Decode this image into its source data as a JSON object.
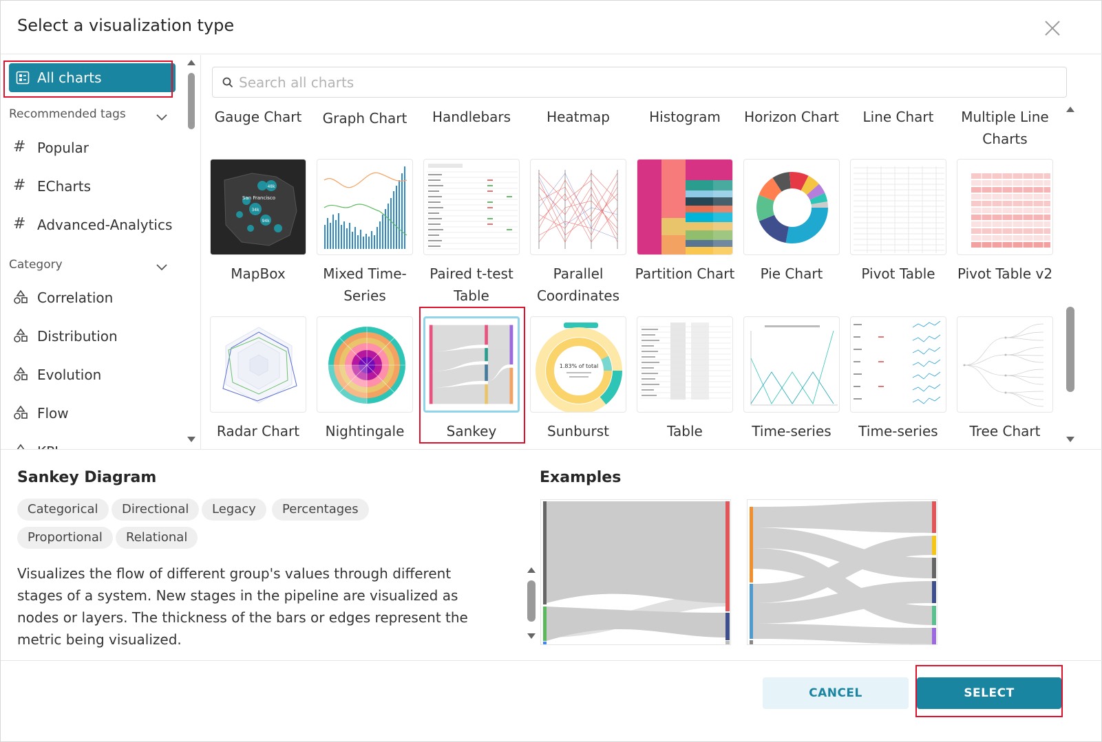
{
  "header": {
    "title": "Select a visualization type"
  },
  "sidebar": {
    "all_charts": "All charts",
    "recommended_tags": "Recommended tags",
    "tags": [
      "Popular",
      "ECharts",
      "Advanced-Analytics"
    ],
    "category": "Category",
    "categories": [
      "Correlation",
      "Distribution",
      "Evolution",
      "Flow",
      "KPI"
    ]
  },
  "search": {
    "placeholder": "Search all charts",
    "value": ""
  },
  "grid": {
    "row0": [
      "Gauge Chart",
      "Graph Chart",
      "Handlebars",
      "Heatmap",
      "Histogram",
      "Horizon Chart",
      "Line Chart",
      "Multiple Line Charts"
    ],
    "row1": [
      "MapBox",
      "Mixed Time-Series",
      "Paired t-test Table",
      "Parallel Coordinates",
      "Partition Chart",
      "Pie Chart",
      "Pivot Table",
      "Pivot Table v2"
    ],
    "row2": [
      "Radar Chart",
      "Nightingale",
      "Sankey",
      "Sunburst",
      "Table",
      "Time-series",
      "Time-series",
      "Tree Chart"
    ],
    "selected": "Sankey"
  },
  "thumb_text": {
    "mapbox_city": "San Francisco",
    "mapbox_count": "34k",
    "mapbox_top": "48k",
    "mapbox_side": "94k",
    "sunburst_pct": "1.83% of total"
  },
  "details": {
    "title": "Sankey Diagram",
    "tags": [
      "Categorical",
      "Directional",
      "Legacy",
      "Percentages",
      "Proportional",
      "Relational"
    ],
    "description": "Visualizes the flow of different group's values through different stages of a system. New stages in the pipeline are visualized as nodes or layers. The thickness of the bars or edges represent the metric being visualized.",
    "examples_title": "Examples"
  },
  "footer": {
    "cancel": "CANCEL",
    "select": "SELECT"
  },
  "colors": {
    "accent": "#1a85a0",
    "highlight": "#e0102a",
    "selected_border": "#8fd4e8"
  }
}
